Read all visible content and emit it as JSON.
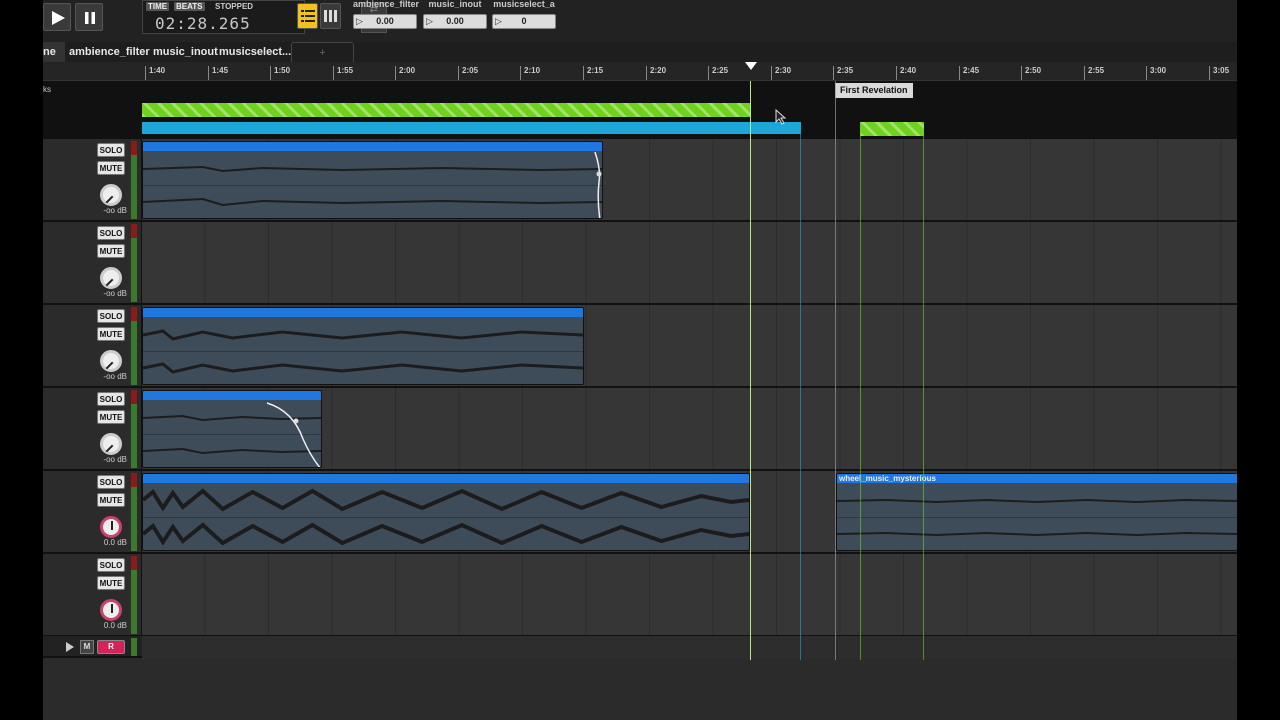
{
  "transport": {
    "play_icon": "play-icon",
    "pause_icon": "pause-icon",
    "time_label": "TIME",
    "beats_label": "BEATS",
    "status": "STOPPED",
    "time": "02:28.265"
  },
  "parameters": [
    {
      "name": "ambience_filter",
      "value": "0.00"
    },
    {
      "name": "music_inout",
      "value": "0.00"
    },
    {
      "name": "musicselect_a",
      "value": "0"
    }
  ],
  "tabs": [
    "ne",
    "ambience_filter",
    "music_inout",
    "musicselect...",
    "+"
  ],
  "ruler": {
    "ticks": [
      "1:40",
      "1:45",
      "1:50",
      "1:55",
      "2:00",
      "2:05",
      "2:10",
      "2:15",
      "2:20",
      "2:25",
      "2:30",
      "2:35",
      "2:40",
      "2:45",
      "2:50",
      "2:55",
      "3:00",
      "3:05"
    ],
    "playhead_time": "2:28.265"
  },
  "markers": {
    "lane_label": "ks",
    "first_revelation": "First Revelation"
  },
  "tracks": [
    {
      "solo": "SOLO",
      "mute": "MUTE",
      "db": "-oo dB"
    },
    {
      "solo": "SOLO",
      "mute": "MUTE",
      "db": "-oo dB"
    },
    {
      "solo": "SOLO",
      "mute": "MUTE",
      "db": "-oo dB"
    },
    {
      "solo": "SOLO",
      "mute": "MUTE",
      "db": "-oo dB"
    },
    {
      "solo": "SOLO",
      "mute": "MUTE",
      "db": "0.0 dB",
      "clip_name": "wheel_music_mysterious"
    },
    {
      "solo": "SOLO",
      "mute": "MUTE",
      "db": "0.0 dB"
    }
  ],
  "master": {
    "m_label": "M",
    "rec_label": "R"
  },
  "colors": {
    "accent_green": "#6fd21c",
    "accent_blue": "#1da6d8",
    "clip_header": "#1f77e0",
    "view_button": "#f2c21b"
  }
}
